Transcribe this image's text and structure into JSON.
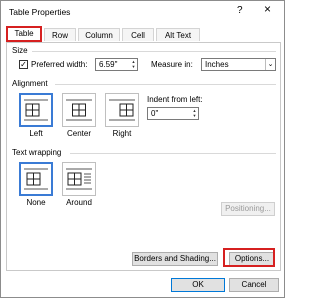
{
  "window": {
    "title": "Table Properties",
    "help_glyph": "?",
    "close_glyph": "×"
  },
  "tabs": [
    {
      "label": "Table",
      "active": true
    },
    {
      "label": "Row",
      "active": false
    },
    {
      "label": "Column",
      "active": false
    },
    {
      "label": "Cell",
      "active": false
    },
    {
      "label": "Alt Text",
      "active": false
    }
  ],
  "size": {
    "group_label": "Size",
    "preferred_width_label": "Preferred width:",
    "preferred_width_checked": true,
    "preferred_width_value": "6.59\"",
    "measure_in_label": "Measure in:",
    "measure_in_value": "Inches"
  },
  "alignment": {
    "group_label": "Alignment",
    "options": [
      {
        "label": "Left",
        "selected": true
      },
      {
        "label": "Center",
        "selected": false
      },
      {
        "label": "Right",
        "selected": false
      }
    ],
    "indent_label": "Indent from left:",
    "indent_value": "0\""
  },
  "text_wrapping": {
    "group_label": "Text wrapping",
    "options": [
      {
        "label": "None",
        "selected": true
      },
      {
        "label": "Around",
        "selected": false
      }
    ],
    "positioning_button": "Positioning..."
  },
  "buttons": {
    "borders_shading": "Borders and Shading...",
    "options": "Options...",
    "ok": "OK",
    "cancel": "Cancel"
  },
  "colors": {
    "highlight": "#d62020",
    "selection": "#3a7bd5"
  }
}
